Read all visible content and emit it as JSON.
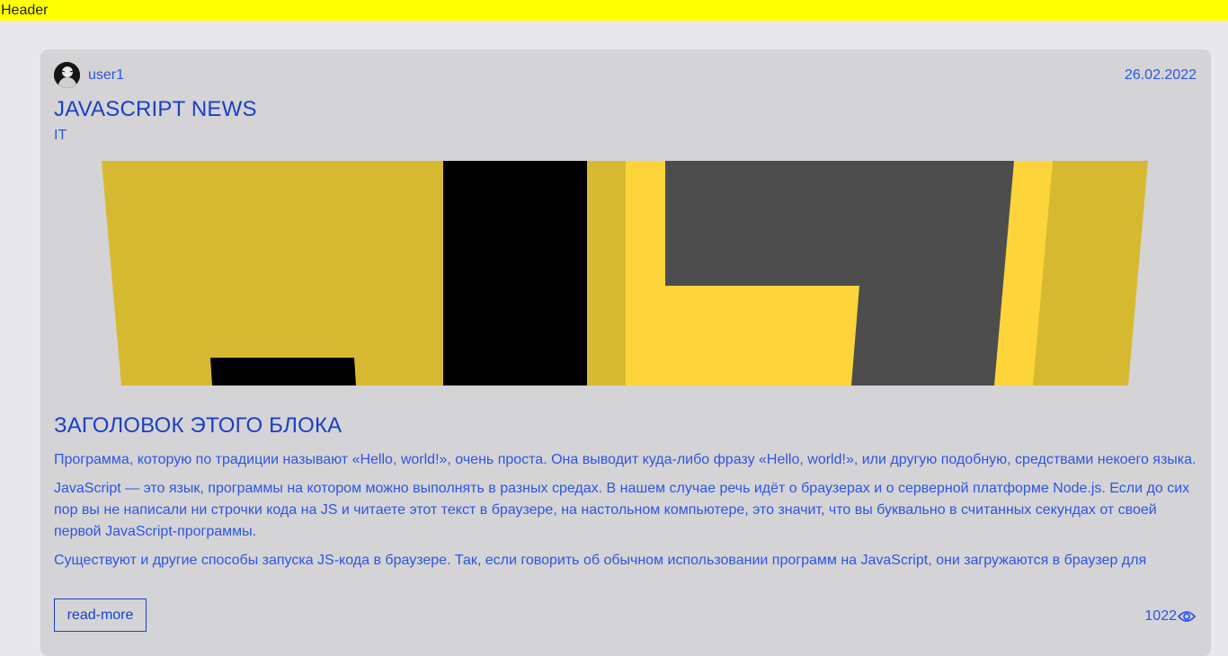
{
  "header": {
    "label": "Header"
  },
  "post": {
    "username": "user1",
    "date": "26.02.2022",
    "title": "JAVASCRIPT NEWS",
    "category": "IT",
    "block_title": "ЗАГОЛОВОК ЭТОГО БЛОКА",
    "paragraphs": [
      "Программа, которую по традиции называют «Hello, world!», очень проста. Она выводит куда-либо фразу «Hello, world!», или другую подобную, средствами некоего языка.",
      "JavaScript — это язык, программы на котором можно выполнять в разных средах. В нашем случае речь идёт о браузерах и о серверной платформе Node.js. Если до сих пор вы не написали ни строчки кода на JS и читаете этот текст в браузере, на настольном компьютере, это значит, что вы буквально в считанных секундах от своей первой JavaScript-программы.",
      "Существуют и другие способы запуска JS-кода в браузере. Так, если говорить об обычном использовании программ на JavaScript, они загружаются в браузер для"
    ],
    "read_more_label": "read-more",
    "views": "1022"
  },
  "icons": {
    "avatar": "user-avatar",
    "views": "eye-icon",
    "banner": "js-logo-banner"
  },
  "colors": {
    "header_bg": "#ffff00",
    "card_bg": "#d4d4d7",
    "page_bg": "#e8e8ea",
    "text_blue": "#2d55e0",
    "title_blue": "#1b3fc4",
    "banner_yellow": "#d6b930",
    "banner_light_yellow": "#fdd53a",
    "banner_gray": "#4d4d4d"
  }
}
